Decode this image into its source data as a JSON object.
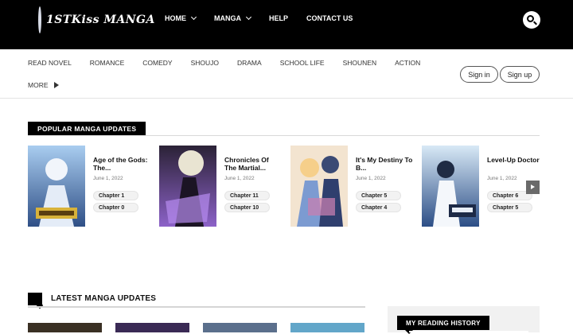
{
  "header": {
    "logo_text": "1STKiss MANGA",
    "nav": [
      {
        "label": "HOME",
        "has_dropdown": true
      },
      {
        "label": "MANGA",
        "has_dropdown": true
      },
      {
        "label": "HELP",
        "has_dropdown": false
      },
      {
        "label": "CONTACT US",
        "has_dropdown": false
      }
    ],
    "search_icon": "search-icon"
  },
  "genres": {
    "items": [
      "READ NOVEL",
      "ROMANCE",
      "COMEDY",
      "SHOUJO",
      "DRAMA",
      "SCHOOL LIFE",
      "SHOUNEN",
      "ACTION"
    ],
    "more_label": "MORE"
  },
  "auth": {
    "signin_label": "Sign in",
    "signup_label": "Sign up"
  },
  "popular": {
    "heading": "POPULAR MANGA UPDATES",
    "cards": [
      {
        "title": "Age of the Gods: The...",
        "date": "June 1, 2022",
        "chapters": [
          "Chapter 1",
          "Chapter 0"
        ],
        "cover_colors": [
          "#6ea4d8",
          "#2f4f86"
        ]
      },
      {
        "title": "Chronicles Of The Martial...",
        "date": "June 1, 2022",
        "chapters": [
          "Chapter 11",
          "Chapter 10"
        ],
        "cover_colors": [
          "#3a2a57",
          "#8c62c8"
        ]
      },
      {
        "title": "It's My Destiny To B...",
        "date": "June 1, 2022",
        "chapters": [
          "Chapter 5",
          "Chapter 4"
        ],
        "cover_colors": [
          "#e9c9a6",
          "#5b7bb8"
        ]
      },
      {
        "title": "Level-Up Doctor",
        "date": "June 1, 2022",
        "chapters": [
          "Chapter 6",
          "Chapter 5"
        ],
        "cover_colors": [
          "#bcd7ee",
          "#2c4e86"
        ]
      }
    ]
  },
  "latest": {
    "heading": "LATEST MANGA UPDATES"
  },
  "history": {
    "heading": "MY READING HISTORY"
  },
  "colors": {
    "header_bg": "#000000",
    "tag_bg": "#000000",
    "arrow_bg": "#6a6a6a"
  }
}
